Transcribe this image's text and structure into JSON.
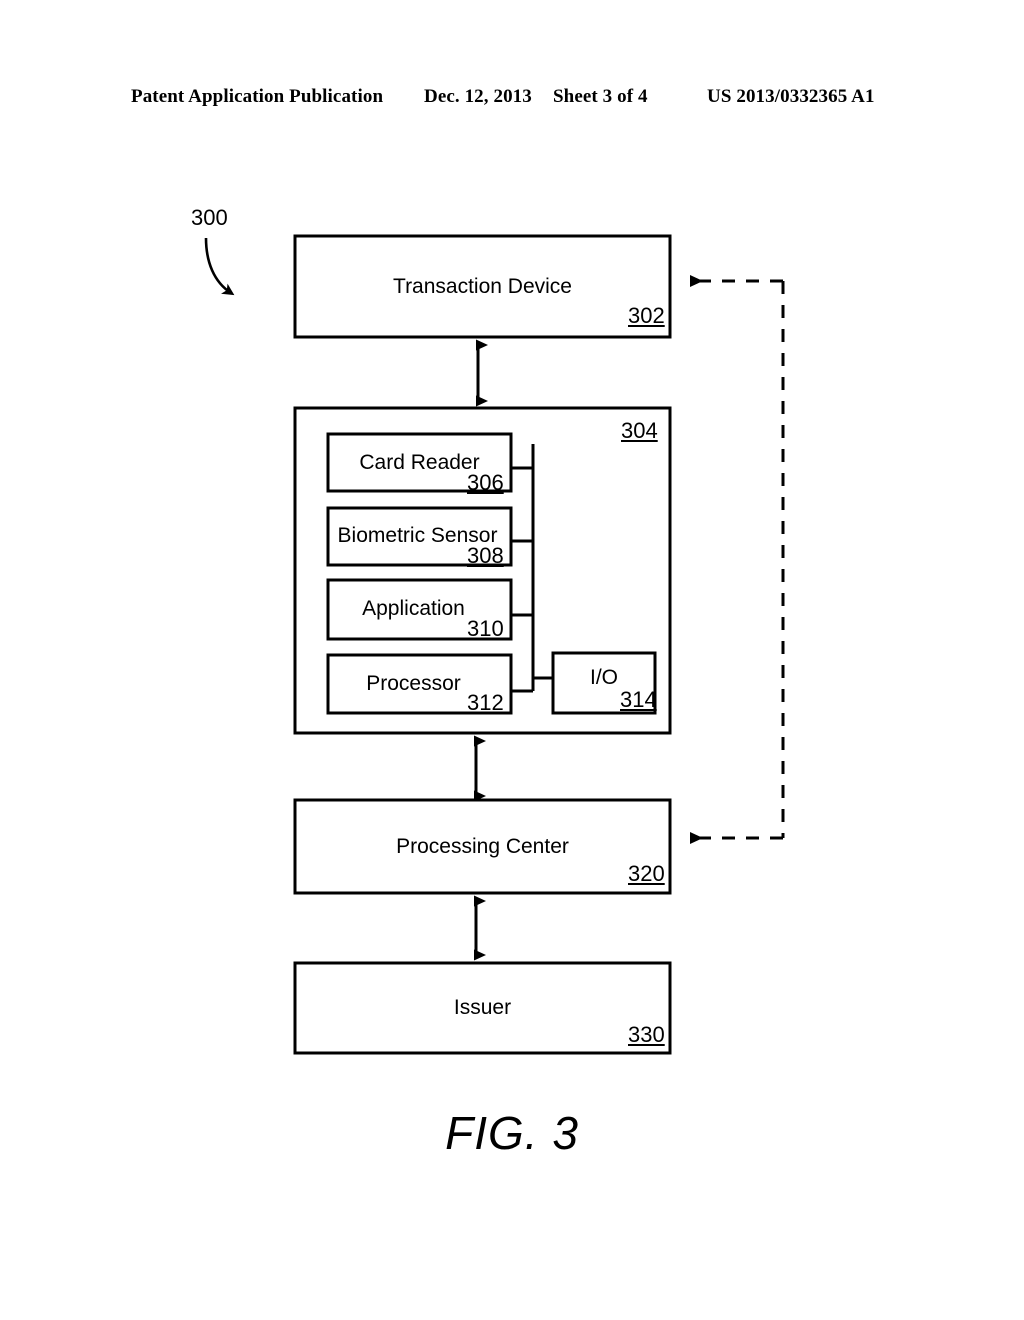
{
  "header": {
    "publication": "Patent Application Publication",
    "date": "Dec. 12, 2013",
    "sheet": "Sheet 3 of 4",
    "patent_number": "US 2013/0332365 A1"
  },
  "figure": {
    "caption": "FIG.  3",
    "system_callout": "300",
    "blocks": [
      {
        "id": "transaction-device",
        "label": "Transaction Device",
        "ref": "302"
      },
      {
        "id": "device-enclosure",
        "label": "",
        "ref": "304"
      },
      {
        "id": "card-reader",
        "label": "Card Reader",
        "ref": "306"
      },
      {
        "id": "biometric-sensor",
        "label": "Biometric Sensor",
        "ref": "308"
      },
      {
        "id": "application",
        "label": "Application",
        "ref": "310"
      },
      {
        "id": "processor",
        "label": "Processor",
        "ref": "312"
      },
      {
        "id": "io",
        "label": "I/O",
        "ref": "314"
      },
      {
        "id": "processing-center",
        "label": "Processing Center",
        "ref": "320"
      },
      {
        "id": "issuer",
        "label": "Issuer",
        "ref": "330"
      }
    ],
    "connectors": [
      {
        "id": "transaction-to-enclosure",
        "style": "solid",
        "arrows": "double",
        "from": "transaction-device",
        "to": "device-enclosure"
      },
      {
        "id": "enclosure-to-processing",
        "style": "solid",
        "arrows": "double",
        "from": "device-enclosure",
        "to": "processing-center"
      },
      {
        "id": "processing-to-issuer",
        "style": "solid",
        "arrows": "double",
        "from": "processing-center",
        "to": "issuer"
      },
      {
        "id": "feedback-bus",
        "style": "dashed",
        "arrows": "single",
        "from": "processing-center",
        "to": "transaction-device"
      }
    ],
    "colors": {
      "ink": "#000000",
      "page": "#ffffff"
    }
  }
}
